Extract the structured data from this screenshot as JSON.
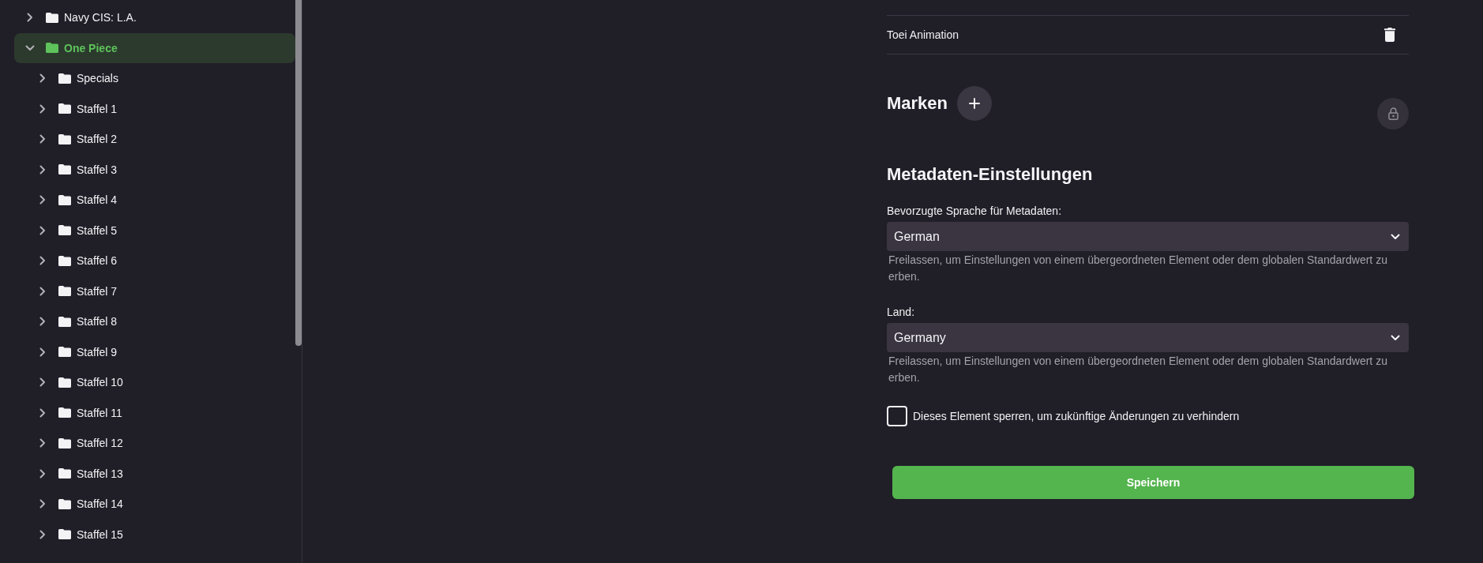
{
  "sidebar": {
    "tree": [
      {
        "label": "Navy CIS: L.A.",
        "expanded": false,
        "selected": false
      },
      {
        "label": "One Piece",
        "expanded": true,
        "selected": true,
        "children": [
          {
            "label": "Specials",
            "expanded": false,
            "selected": false
          },
          {
            "label": "Staffel 1",
            "expanded": false,
            "selected": false
          },
          {
            "label": "Staffel 2",
            "expanded": false,
            "selected": false
          },
          {
            "label": "Staffel 3",
            "expanded": false,
            "selected": false
          },
          {
            "label": "Staffel 4",
            "expanded": false,
            "selected": false
          },
          {
            "label": "Staffel 5",
            "expanded": false,
            "selected": false
          },
          {
            "label": "Staffel 6",
            "expanded": false,
            "selected": false
          },
          {
            "label": "Staffel 7",
            "expanded": false,
            "selected": false
          },
          {
            "label": "Staffel 8",
            "expanded": false,
            "selected": false
          },
          {
            "label": "Staffel 9",
            "expanded": false,
            "selected": false
          },
          {
            "label": "Staffel 10",
            "expanded": false,
            "selected": false
          },
          {
            "label": "Staffel 11",
            "expanded": false,
            "selected": false
          },
          {
            "label": "Staffel 12",
            "expanded": false,
            "selected": false
          },
          {
            "label": "Staffel 13",
            "expanded": false,
            "selected": false
          },
          {
            "label": "Staffel 14",
            "expanded": false,
            "selected": false
          },
          {
            "label": "Staffel 15",
            "expanded": false,
            "selected": false
          }
        ]
      }
    ]
  },
  "studios": [
    {
      "name": "Toei Animation"
    }
  ],
  "tags_section": {
    "title": "Marken"
  },
  "metadata_settings": {
    "title": "Metadaten-Einstellungen",
    "fields": [
      {
        "label": "Bevorzugte Sprache für Metadaten:",
        "value": "German",
        "hint": "Freilassen, um Einstellungen von einem übergeordneten Element oder dem globalen Standardwert zu erben."
      },
      {
        "label": "Land:",
        "value": "Germany",
        "hint": "Freilassen, um Einstellungen von einem übergeordneten Element oder dem globalen Standardwert zu erben."
      }
    ]
  },
  "lock_checkbox": {
    "label": "Dieses Element sperren, um zukünftige Änderungen zu verhindern",
    "checked": false
  },
  "save_button": {
    "label": "Speichern"
  }
}
